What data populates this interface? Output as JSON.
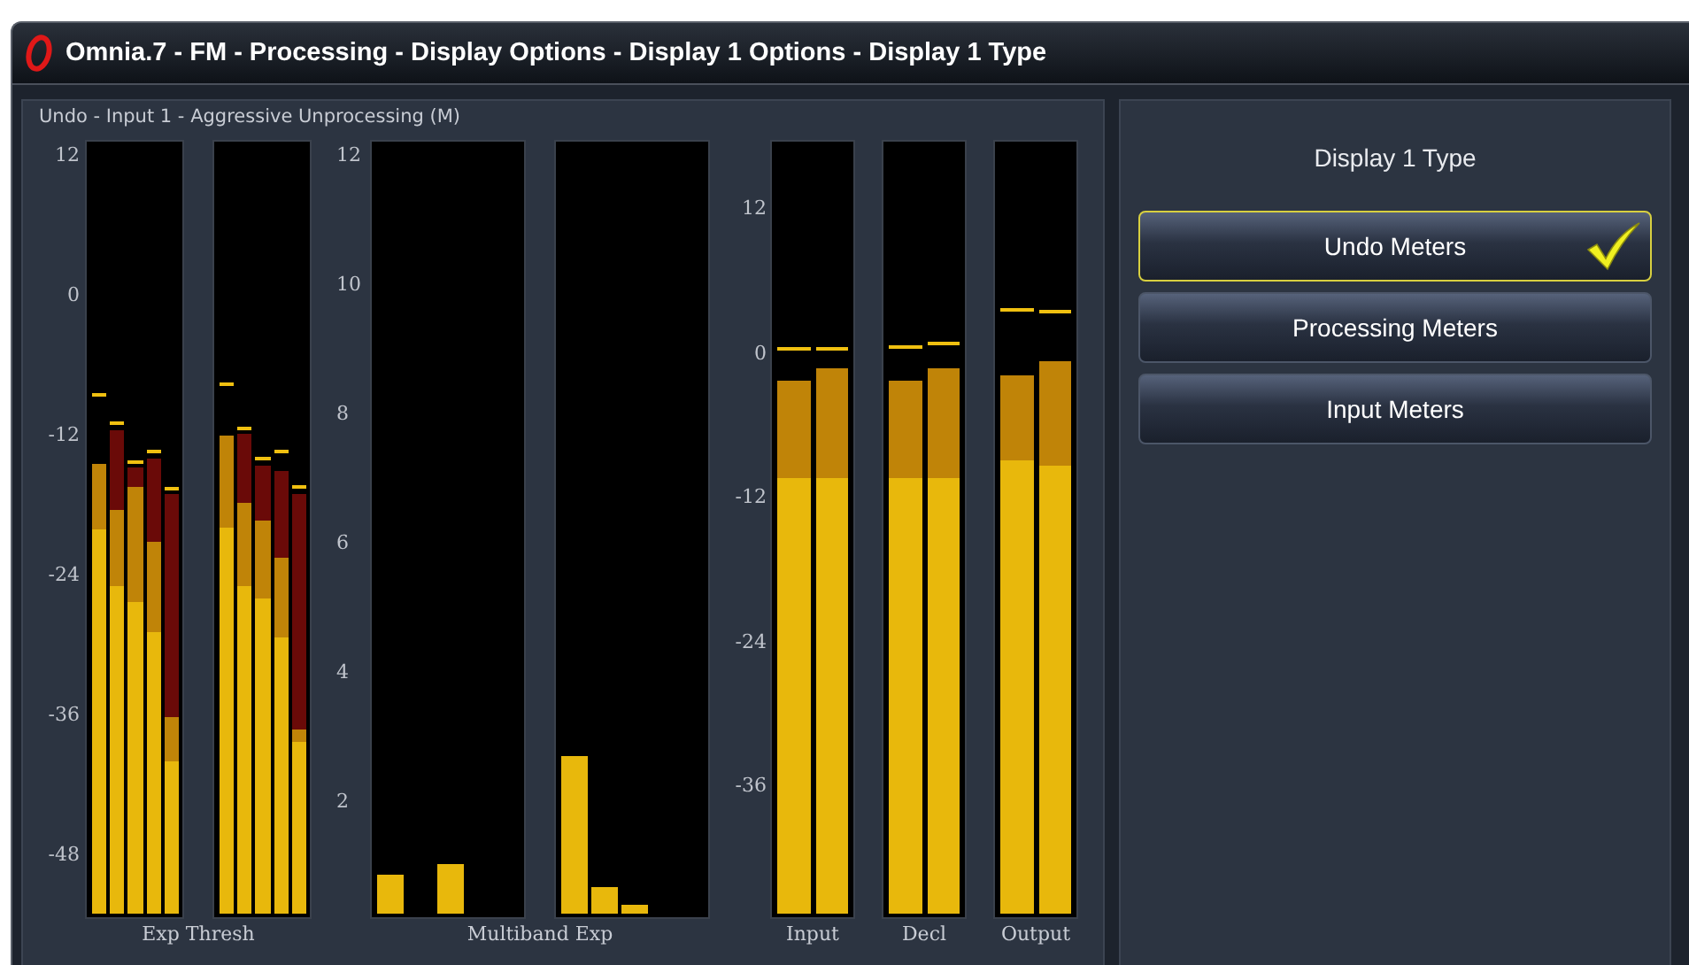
{
  "window": {
    "title": "Omnia.7 - FM - Processing - Display Options - Display 1 Options - Display 1 Type"
  },
  "meter_panel": {
    "title": "Undo - Input 1 - Aggressive Unprocessing (M)",
    "groups": [
      {
        "kind": "threshold",
        "ticks": [
          "12",
          "0",
          "-12",
          "-24",
          "-36",
          "-48"
        ],
        "label": "Exp Thresh",
        "meters": [
          {
            "bars": [
              {
                "fills": [
                  {
                    "kind": "orange",
                    "level": 0.586
                  },
                  {
                    "kind": "yellow",
                    "level": 0.5
                  }
                ],
                "peak": {
                  "level": 0.673
                }
              },
              {
                "fills": [
                  {
                    "kind": "red",
                    "level": 0.63
                  },
                  {
                    "kind": "orange",
                    "level": 0.525
                  },
                  {
                    "kind": "yellow",
                    "level": 0.427
                  }
                ],
                "peak": {
                  "level": 0.636
                }
              },
              {
                "fills": [
                  {
                    "kind": "red",
                    "level": 0.58
                  },
                  {
                    "kind": "orange",
                    "level": 0.555
                  },
                  {
                    "kind": "yellow",
                    "level": 0.405
                  }
                ],
                "peak": {
                  "level": 0.586
                }
              },
              {
                "fills": [
                  {
                    "kind": "red",
                    "level": 0.593
                  },
                  {
                    "kind": "orange",
                    "level": 0.484
                  },
                  {
                    "kind": "yellow",
                    "level": 0.366
                  }
                ],
                "peak": {
                  "level": 0.6
                }
              },
              {
                "fills": [
                  {
                    "kind": "red",
                    "level": 0.545
                  },
                  {
                    "kind": "orange",
                    "level": 0.255
                  },
                  {
                    "kind": "yellow",
                    "level": 0.198
                  }
                ],
                "peak": {
                  "level": 0.55
                }
              }
            ]
          },
          {
            "bars": [
              {
                "fills": [
                  {
                    "kind": "orange",
                    "level": 0.623
                  },
                  {
                    "kind": "yellow",
                    "level": 0.502
                  }
                ],
                "peak": {
                  "level": 0.686
                }
              },
              {
                "fills": [
                  {
                    "kind": "red",
                    "level": 0.625
                  },
                  {
                    "kind": "orange",
                    "level": 0.534
                  },
                  {
                    "kind": "yellow",
                    "level": 0.427
                  }
                ],
                "peak": {
                  "level": 0.63
                }
              },
              {
                "fills": [
                  {
                    "kind": "red",
                    "level": 0.582
                  },
                  {
                    "kind": "orange",
                    "level": 0.511
                  },
                  {
                    "kind": "yellow",
                    "level": 0.411
                  }
                ],
                "peak": {
                  "level": 0.59
                }
              },
              {
                "fills": [
                  {
                    "kind": "red",
                    "level": 0.577
                  },
                  {
                    "kind": "orange",
                    "level": 0.464
                  },
                  {
                    "kind": "yellow",
                    "level": 0.359
                  }
                ],
                "peak": {
                  "level": 0.6
                }
              },
              {
                "fills": [
                  {
                    "kind": "red",
                    "level": 0.545
                  },
                  {
                    "kind": "orange",
                    "level": 0.239
                  },
                  {
                    "kind": "yellow",
                    "level": 0.223
                  }
                ],
                "peak": {
                  "level": 0.553
                }
              }
            ]
          }
        ]
      },
      {
        "kind": "multiband",
        "ticks": [
          "12",
          "10",
          "8",
          "6",
          "4",
          "2"
        ],
        "label": "Multiband Exp",
        "meters": [
          {
            "bars": [
              {
                "fills": [
                  {
                    "kind": "yellow",
                    "level": 0.05
                  }
                ]
              },
              {
                "fills": [
                  {
                    "kind": "yellow",
                    "level": 0.064
                  }
                ]
              }
            ]
          },
          {
            "bars": [
              {
                "fills": [
                  {
                    "kind": "yellow",
                    "level": 0.205
                  }
                ]
              },
              {
                "fills": [
                  {
                    "kind": "yellow",
                    "level": 0.034
                  }
                ]
              },
              {
                "fills": [
                  {
                    "kind": "yellow",
                    "level": 0.011
                  }
                ]
              }
            ]
          }
        ]
      },
      {
        "kind": "io",
        "ticks": [
          "12",
          "0",
          "-12",
          "-24",
          "-36"
        ],
        "meters": [
          {
            "label": "Input",
            "bars": [
              {
                "fills": [
                  {
                    "kind": "orange",
                    "level": 0.693
                  },
                  {
                    "kind": "yellow",
                    "level": 0.566
                  }
                ],
                "peak": {
                  "level": 0.732
                }
              },
              {
                "fills": [
                  {
                    "kind": "orange",
                    "level": 0.709
                  },
                  {
                    "kind": "yellow",
                    "level": 0.566
                  }
                ],
                "peak": {
                  "level": 0.732
                }
              }
            ]
          },
          {
            "label": "Decl",
            "bars": [
              {
                "fills": [
                  {
                    "kind": "orange",
                    "level": 0.693
                  },
                  {
                    "kind": "yellow",
                    "level": 0.566
                  }
                ],
                "peak": {
                  "level": 0.734
                }
              },
              {
                "fills": [
                  {
                    "kind": "orange",
                    "level": 0.709
                  },
                  {
                    "kind": "yellow",
                    "level": 0.566
                  }
                ],
                "peak": {
                  "level": 0.739
                }
              }
            ]
          },
          {
            "label": "Output",
            "bars": [
              {
                "fills": [
                  {
                    "kind": "orange",
                    "level": 0.7
                  },
                  {
                    "kind": "yellow",
                    "level": 0.589
                  }
                ],
                "peak": {
                  "level": 0.784
                }
              },
              {
                "fills": [
                  {
                    "kind": "orange",
                    "level": 0.718
                  },
                  {
                    "kind": "yellow",
                    "level": 0.582
                  }
                ],
                "peak": {
                  "level": 0.78
                }
              }
            ]
          }
        ]
      }
    ]
  },
  "options_panel": {
    "title": "Display 1 Type",
    "options": [
      {
        "label": "Undo Meters",
        "selected": true
      },
      {
        "label": "Processing Meters",
        "selected": false
      },
      {
        "label": "Input Meters",
        "selected": false
      }
    ]
  }
}
